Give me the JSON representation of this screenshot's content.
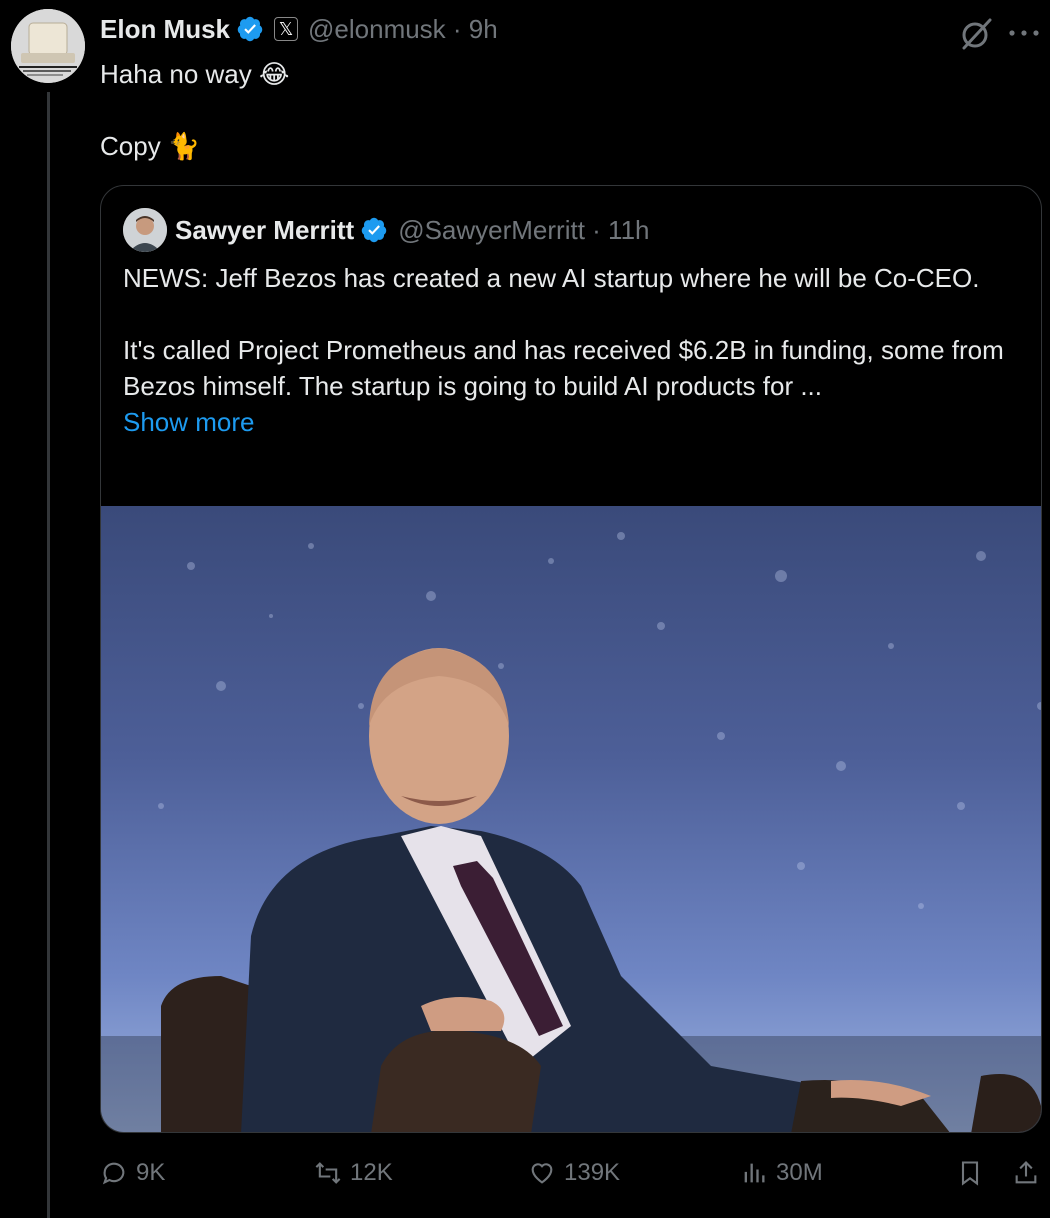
{
  "tweet": {
    "author_name": "Elon Musk",
    "author_handle": "@elonmusk",
    "separator": " · ",
    "time": "9h",
    "x_badge": "𝕏",
    "text": "Haha no way 😂\n\nCopy 🐈"
  },
  "quoted": {
    "author_name": "Sawyer Merritt",
    "author_handle": "@SawyerMerritt",
    "separator": " · ",
    "time": "11h",
    "paragraph1": "NEWS: Jeff Bezos has created a new AI startup where he will be Co-CEO.",
    "paragraph2": "It's called Project Prometheus and has received $6.2B in funding, some from Bezos himself. The startup is going to build AI products for ...",
    "show_more": "Show more"
  },
  "actions": {
    "replies": "9K",
    "reposts": "12K",
    "likes": "139K",
    "views": "30M"
  },
  "colors": {
    "background": "#000000",
    "text": "#e7e9ea",
    "muted": "#71767b",
    "link": "#1d9bf0",
    "verified": "#1d9bf0",
    "border": "#333639"
  },
  "icons": [
    "verified-badge-icon",
    "x-logo-icon",
    "grok-icon",
    "more-icon",
    "reply-icon",
    "repost-icon",
    "like-icon",
    "views-icon",
    "bookmark-icon",
    "share-icon"
  ]
}
